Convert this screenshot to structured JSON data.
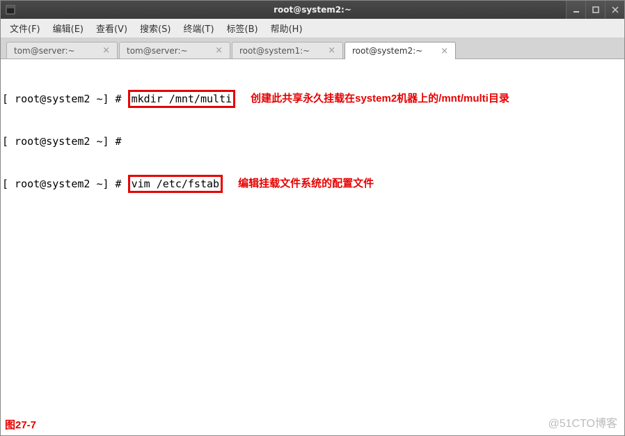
{
  "titlebar": {
    "title": "root@system2:~"
  },
  "menubar": {
    "items": [
      {
        "label": "文件(F)"
      },
      {
        "label": "编辑(E)"
      },
      {
        "label": "查看(V)"
      },
      {
        "label": "搜索(S)"
      },
      {
        "label": "终端(T)"
      },
      {
        "label": "标签(B)"
      },
      {
        "label": "帮助(H)"
      }
    ]
  },
  "tabs": {
    "items": [
      {
        "label": "tom@server:~",
        "active": false
      },
      {
        "label": "tom@server:~",
        "active": false
      },
      {
        "label": "root@system1:~",
        "active": false
      },
      {
        "label": "root@system2:~",
        "active": true
      }
    ]
  },
  "terminal": {
    "lines": [
      {
        "prompt": "[ root@system2 ~] # ",
        "cmd": "mkdir /mnt/multi",
        "boxed": true,
        "annotation": "创建此共享永久挂载在system2机器上的/mnt/multi目录"
      },
      {
        "prompt": "[ root@system2 ~] # ",
        "cmd": "",
        "boxed": false,
        "annotation": ""
      },
      {
        "prompt": "[ root@system2 ~] # ",
        "cmd": "vim /etc/fstab",
        "boxed": true,
        "annotation": "编辑挂载文件系统的配置文件"
      }
    ]
  },
  "figure_label": "图27-7",
  "watermark": "@51CTO博客"
}
